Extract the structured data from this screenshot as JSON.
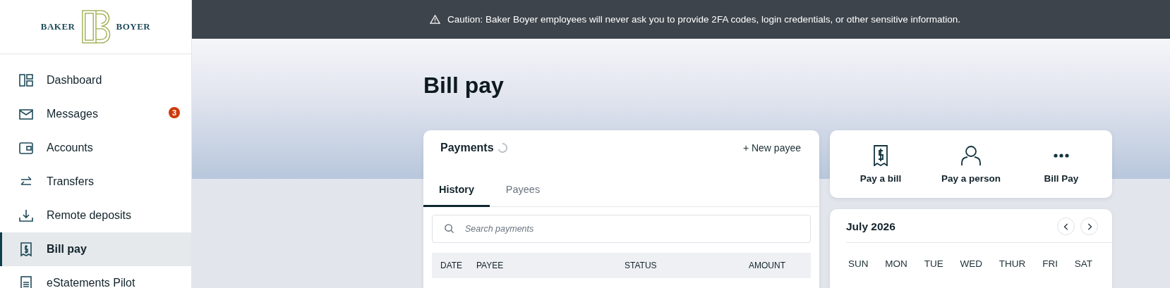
{
  "banner": {
    "text": "Caution: Baker Boyer employees will never ask you to provide 2FA codes, login credentials, or other sensitive information."
  },
  "logo": {
    "left": "BAKER",
    "right": "BOYER"
  },
  "sidebar": {
    "items": [
      {
        "label": "Dashboard",
        "kind": "dashboard",
        "selected": false
      },
      {
        "label": "Messages",
        "kind": "mail",
        "selected": false,
        "badge": "3"
      },
      {
        "label": "Accounts",
        "kind": "wallet",
        "selected": false
      },
      {
        "label": "Transfers",
        "kind": "transfer",
        "selected": false
      },
      {
        "label": "Remote deposits",
        "kind": "deposit",
        "selected": false
      },
      {
        "label": "Bill pay",
        "kind": "bill",
        "selected": true
      },
      {
        "label": "eStatements Pilot",
        "kind": "statement",
        "selected": false
      }
    ]
  },
  "page": {
    "title": "Bill pay"
  },
  "payments": {
    "title": "Payments",
    "loading": true,
    "new_payee": "+ New payee",
    "tabs": [
      {
        "label": "History",
        "selected": true
      },
      {
        "label": "Payees",
        "selected": false
      }
    ],
    "search": {
      "placeholder": "Search payments"
    },
    "columns": [
      "DATE",
      "PAYEE",
      "STATUS",
      "AMOUNT"
    ]
  },
  "actions": [
    {
      "label": "Pay a bill",
      "kind": "bill"
    },
    {
      "label": "Pay a person",
      "kind": "person"
    },
    {
      "label": "Bill Pay",
      "kind": "more"
    }
  ],
  "calendar": {
    "month": "July 2026",
    "weekdays": [
      "SUN",
      "MON",
      "TUE",
      "WED",
      "THUR",
      "FRI",
      "SAT"
    ]
  }
}
